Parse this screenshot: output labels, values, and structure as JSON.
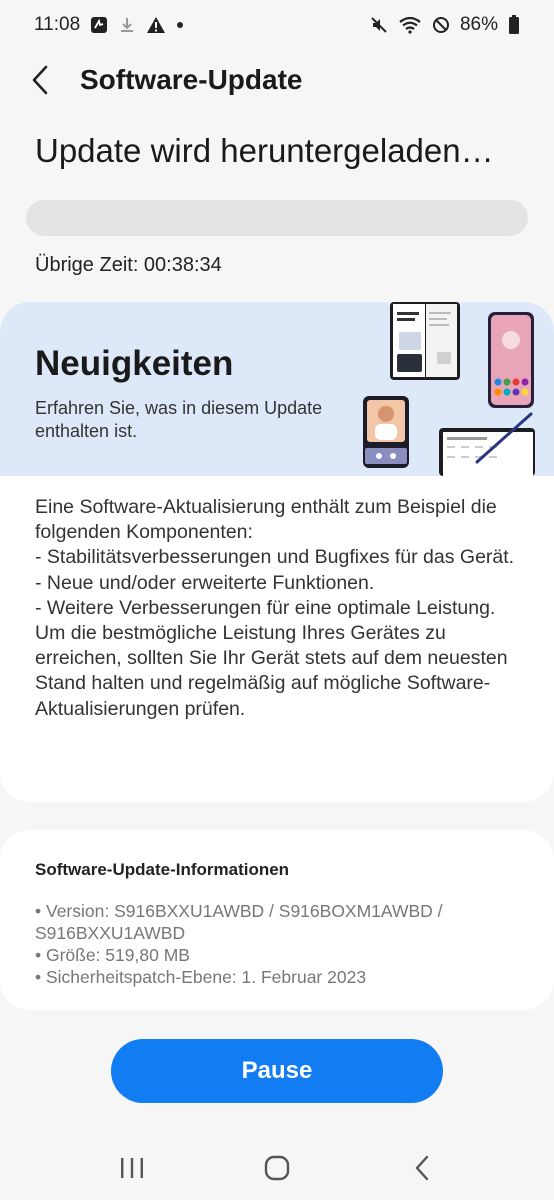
{
  "status_bar": {
    "time": "11:08",
    "battery": "86%",
    "icons": [
      "notification-icon",
      "download-icon",
      "warning-icon",
      "dot-icon",
      "mute-icon",
      "wifi-icon",
      "do-not-disturb-icon",
      "battery-icon"
    ]
  },
  "app_bar": {
    "title": "Software-Update",
    "back_icon": "chevron-left-icon"
  },
  "download": {
    "headline": "Update wird heruntergeladen…",
    "progress": 0.0,
    "remaining_time": "Übrige Zeit: 00:38:34"
  },
  "news": {
    "title": "Neuigkeiten",
    "subtitle": "Erfahren Sie, was in diesem Update enthalten ist.",
    "body": "Eine Software-Aktualisierung enthält zum Beispiel die folgenden Komponenten:\n - Stabilitätsverbesserungen und Bugfixes für das Gerät.\n - Neue und/oder erweiterte Funktionen.\n - Weitere Verbesserungen für eine optimale Leistung.\nUm die bestmögliche Leistung Ihres Gerätes zu erreichen, sollten Sie Ihr Gerät stets auf dem neuesten Stand halten und regelmäßig auf mögliche Software-Aktualisierungen prüfen."
  },
  "info": {
    "title": "Software-Update-Informationen",
    "items": [
      "• Version: S916BXXU1AWBD / S916BOXM1AWBD / S916BXXU1AWBD",
      "• Größe: 519,80 MB",
      "• Sicherheitspatch-Ebene: 1. Februar 2023"
    ]
  },
  "pause_label": "Pause",
  "colors": {
    "accent": "#127df3",
    "banner": "#dde9f9",
    "background": "#f6f6f6"
  }
}
